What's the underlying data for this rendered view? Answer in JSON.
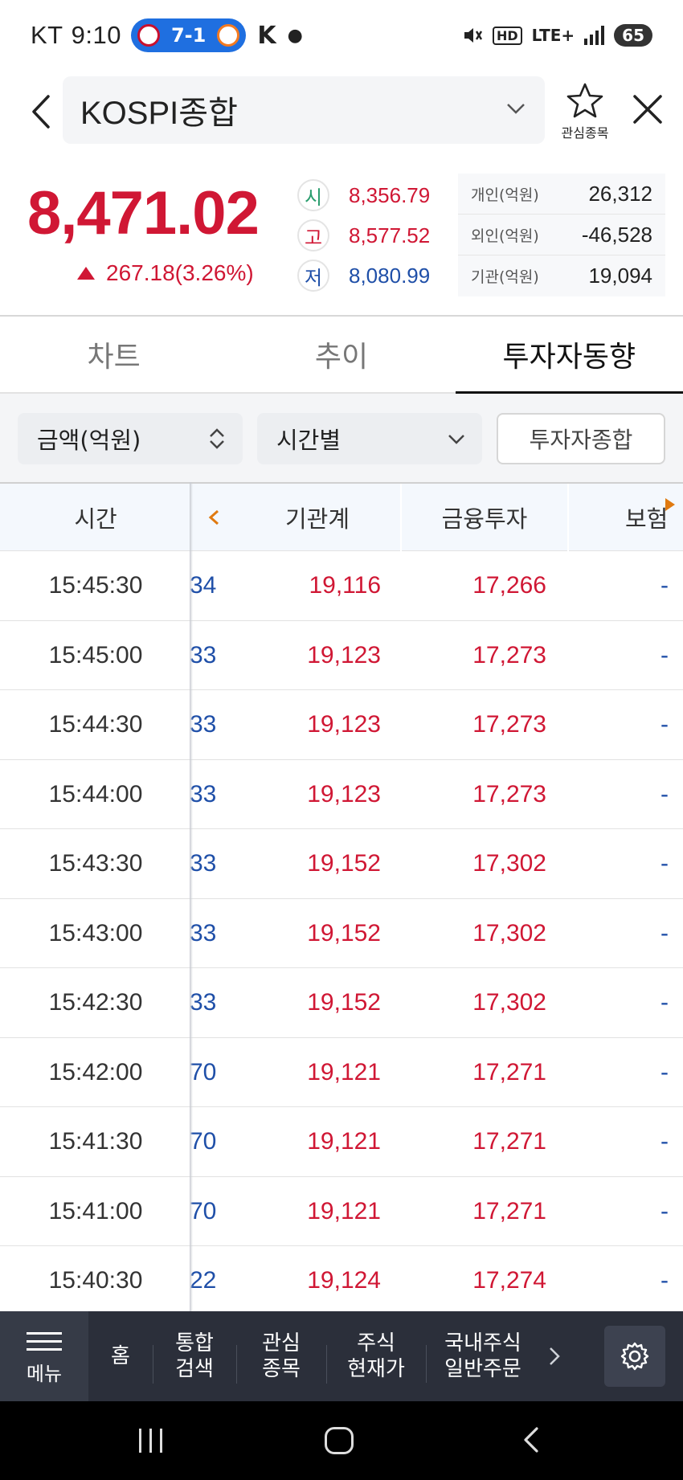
{
  "status": {
    "carrier": "KT",
    "time": "9:10",
    "score": "7-1",
    "network": "LTE+",
    "hd": "HD",
    "battery": "65"
  },
  "header": {
    "title": "KOSPI종합",
    "fav_label": "관심종목"
  },
  "summary": {
    "price": "8,471.02",
    "change": "267.18(3.26%)",
    "open_label": "시",
    "open": "8,356.79",
    "high_label": "고",
    "high": "8,577.52",
    "low_label": "저",
    "low": "8,080.99",
    "flows": [
      {
        "label": "개인(억원)",
        "value": "26,312"
      },
      {
        "label": "외인(억원)",
        "value": "-46,528"
      },
      {
        "label": "기관(억원)",
        "value": "19,094"
      }
    ],
    "colors": {
      "up": "#d01734",
      "down": "#1f4fa8"
    }
  },
  "tabs": [
    {
      "label": "차트"
    },
    {
      "label": "추이"
    },
    {
      "label": "투자자동향"
    }
  ],
  "filters": {
    "unit": "금액(억원)",
    "period": "시간별",
    "invest_button": "투자자종합"
  },
  "table": {
    "headers": {
      "time": "시간",
      "institution": "기관계",
      "financial": "금융투자",
      "insurance": "보험"
    },
    "rows": [
      {
        "time": "15:45:30",
        "prev": "34",
        "inst": "19,116",
        "fin": "17,266",
        "ins": "-"
      },
      {
        "time": "15:45:00",
        "prev": "33",
        "inst": "19,123",
        "fin": "17,273",
        "ins": "-"
      },
      {
        "time": "15:44:30",
        "prev": "33",
        "inst": "19,123",
        "fin": "17,273",
        "ins": "-"
      },
      {
        "time": "15:44:00",
        "prev": "33",
        "inst": "19,123",
        "fin": "17,273",
        "ins": "-"
      },
      {
        "time": "15:43:30",
        "prev": "33",
        "inst": "19,152",
        "fin": "17,302",
        "ins": "-"
      },
      {
        "time": "15:43:00",
        "prev": "33",
        "inst": "19,152",
        "fin": "17,302",
        "ins": "-"
      },
      {
        "time": "15:42:30",
        "prev": "33",
        "inst": "19,152",
        "fin": "17,302",
        "ins": "-"
      },
      {
        "time": "15:42:00",
        "prev": "70",
        "inst": "19,121",
        "fin": "17,271",
        "ins": "-"
      },
      {
        "time": "15:41:30",
        "prev": "70",
        "inst": "19,121",
        "fin": "17,271",
        "ins": "-"
      },
      {
        "time": "15:41:00",
        "prev": "70",
        "inst": "19,121",
        "fin": "17,271",
        "ins": "-"
      },
      {
        "time": "15:40:30",
        "prev": "22",
        "inst": "19,124",
        "fin": "17,274",
        "ins": "-"
      }
    ]
  },
  "appmenu": {
    "menu_label": "메뉴",
    "items": [
      {
        "label": "홈"
      },
      {
        "label": "통합\n검색"
      },
      {
        "label": "관심\n종목"
      },
      {
        "label": "주식\n현재가"
      },
      {
        "label": "국내주식\n일반주문"
      }
    ]
  }
}
